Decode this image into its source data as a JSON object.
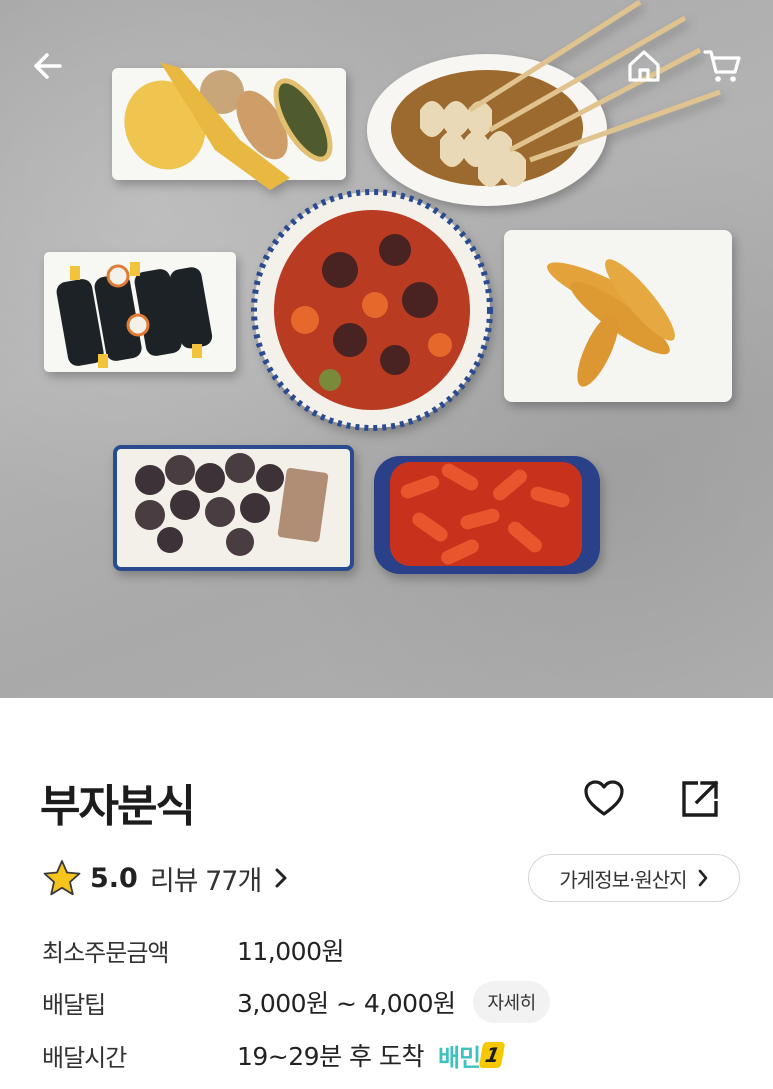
{
  "store": {
    "name": "부자분식"
  },
  "rating": {
    "value": "5.0",
    "review_label": "리뷰 77개"
  },
  "info_button": {
    "label": "가게정보·원산지"
  },
  "details": {
    "min_order_label": "최소주문금액",
    "min_order_value": "11,000원",
    "delivery_tip_label": "배달팁",
    "delivery_tip_value": "3,000원 ~ 4,000원",
    "detail_button": "자세히",
    "delivery_time_label": "배달시간",
    "delivery_time_value": "19~29분 후 도착",
    "badge_text": "배민",
    "badge_num": "1"
  },
  "colors": {
    "accent_teal": "#3fc1bd",
    "star_yellow": "#f6c41c",
    "badge_yellow": "#f6c800"
  },
  "icons": {
    "back": "arrow-left-icon",
    "home": "home-icon",
    "cart": "cart-icon",
    "heart": "heart-icon",
    "share": "share-icon",
    "star": "star-icon",
    "chevron": "chevron-right-icon"
  }
}
